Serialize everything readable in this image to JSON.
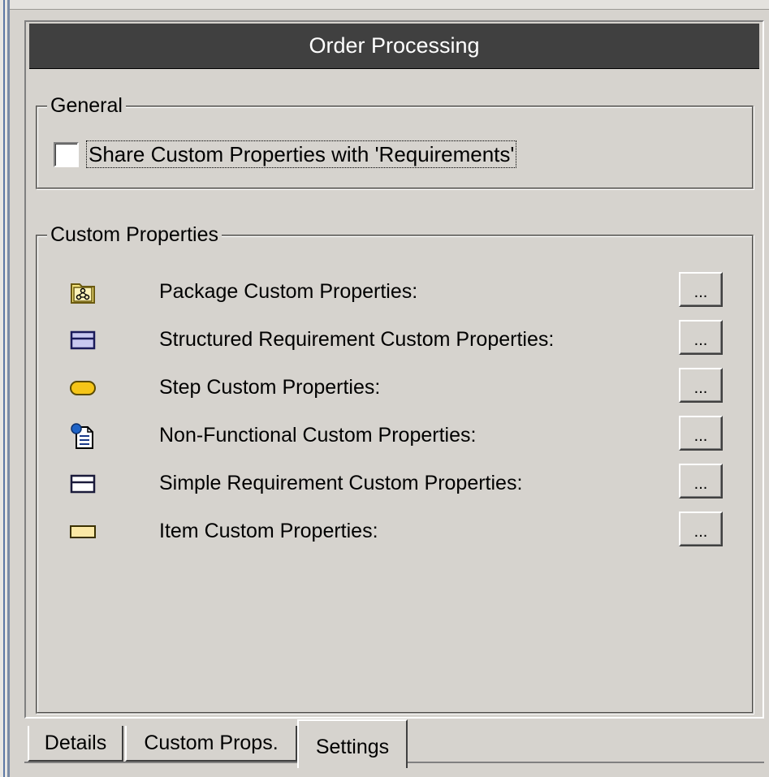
{
  "window": {
    "title": "Order Processing"
  },
  "general": {
    "legend": "General",
    "share_checkbox": {
      "label": "Share Custom Properties with 'Requirements'",
      "checked": false
    }
  },
  "custom_properties": {
    "legend": "Custom Properties",
    "button_label": "...",
    "rows": [
      {
        "icon": "package-icon",
        "label": "Package Custom Properties:"
      },
      {
        "icon": "structured-requirement-icon",
        "label": "Structured Requirement Custom Properties:"
      },
      {
        "icon": "step-icon",
        "label": "Step Custom Properties:"
      },
      {
        "icon": "non-functional-icon",
        "label": "Non-Functional Custom Properties:"
      },
      {
        "icon": "simple-requirement-icon",
        "label": "Simple Requirement Custom Properties:"
      },
      {
        "icon": "item-icon",
        "label": "Item Custom Properties:"
      }
    ]
  },
  "tabs": [
    {
      "label": "Details",
      "active": false
    },
    {
      "label": "Custom Props.",
      "active": false
    },
    {
      "label": "Settings",
      "active": true
    }
  ],
  "colors": {
    "title_bar": "#404040",
    "dialog_bg": "#d6d3ce",
    "structured_requirement": "#c8c8f0",
    "step": "#f5c518",
    "item": "#fbe8a6"
  }
}
